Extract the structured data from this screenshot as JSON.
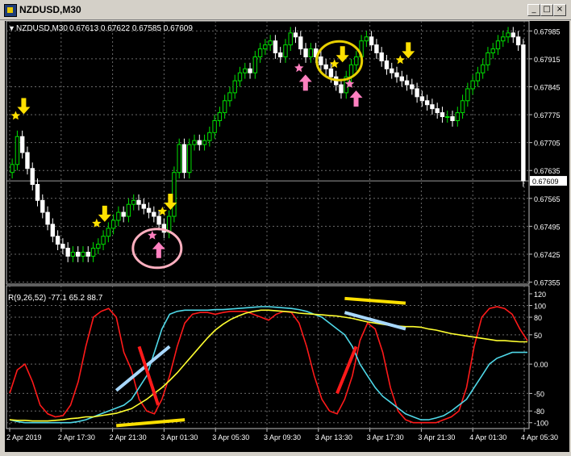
{
  "window": {
    "title": "NZDUSD,M30",
    "minimize_glyph": "_",
    "maximize_glyph": "□",
    "close_glyph": "×"
  },
  "colors": {
    "background": "#000000",
    "grid": "#6a6a6a",
    "bull_candle": "#00e000",
    "bear_candle": "#ffffff",
    "sell_arrow": "#ffe000",
    "buy_arrow": "#ff80c0",
    "rsi_fast": "#ff1a1a",
    "rsi_mid": "#4fd8e8",
    "rsi_slow": "#ffff30",
    "annotation_blue": "#a8d8ff",
    "annotation_red": "#ff1a1a",
    "annotation_yellow": "#ffe000",
    "circle_yellow": "#e8d000",
    "circle_pink": "#ffb0c0"
  },
  "main_chart": {
    "symbol_label": "NZDUSD,M30",
    "ohlc_label": "0.67613 0.67622 0.67585 0.67609",
    "current_price_label": "0.67609",
    "price_labels": [
      "0.67985",
      "0.67915",
      "0.67845",
      "0.67775",
      "0.67705",
      "0.67635",
      "0.67565",
      "0.67495",
      "0.67425",
      "0.67355"
    ]
  },
  "indicator": {
    "label": "R(9,26,52) -77.1 65.2 88.7",
    "level_labels": [
      "120",
      "100",
      "80",
      "50",
      "0.00",
      "-50",
      "-80",
      "-100"
    ]
  },
  "time_labels": [
    "2 Apr 2019",
    "2 Apr 17:30",
    "2 Apr 21:30",
    "3 Apr 01:30",
    "3 Apr 05:30",
    "3 Apr 09:30",
    "3 Apr 13:30",
    "3 Apr 17:30",
    "3 Apr 21:30",
    "4 Apr 01:30",
    "4 Apr 05:30"
  ],
  "icons": {
    "sell_signal": "yellow-down-arrow-icon",
    "buy_signal": "pink-up-arrow-icon",
    "sell_star": "yellow-star-icon",
    "buy_star": "pink-star-icon"
  },
  "chart_data": [
    {
      "type": "candlestick",
      "title": "NZDUSD,M30",
      "ylim": [
        0.6735,
        0.6801
      ],
      "grid": true,
      "y_ticks": [
        0.67985,
        0.67915,
        0.67845,
        0.67775,
        0.67705,
        0.67635,
        0.67565,
        0.67495,
        0.67425,
        0.67355
      ],
      "current_price": 0.67609,
      "series": [
        {
          "name": "close",
          "values": [
            0.6765,
            0.6772,
            0.6768,
            0.6764,
            0.676,
            0.6756,
            0.6753,
            0.675,
            0.6747,
            0.6745,
            0.6744,
            0.6742,
            0.6743,
            0.6742,
            0.6743,
            0.6742,
            0.6744,
            0.6745,
            0.6747,
            0.6749,
            0.6751,
            0.6753,
            0.6752,
            0.6755,
            0.6756,
            0.6755,
            0.6754,
            0.6753,
            0.6752,
            0.675,
            0.6748,
            0.6752,
            0.6763,
            0.677,
            0.6763,
            0.677,
            0.6771,
            0.677,
            0.6771,
            0.6773,
            0.6776,
            0.6778,
            0.6781,
            0.6783,
            0.6786,
            0.6788,
            0.6789,
            0.6788,
            0.6792,
            0.6794,
            0.6795,
            0.6796,
            0.6793,
            0.6792,
            0.6795,
            0.6798,
            0.6797,
            0.6794,
            0.6792,
            0.6794,
            0.6792,
            0.679,
            0.6789,
            0.6787,
            0.6785,
            0.6783,
            0.6787,
            0.679,
            0.6792,
            0.6796,
            0.6797,
            0.6795,
            0.6793,
            0.6791,
            0.6789,
            0.6788,
            0.6787,
            0.6786,
            0.6785,
            0.6784,
            0.6782,
            0.6781,
            0.678,
            0.6779,
            0.6778,
            0.6777,
            0.6777,
            0.6776,
            0.6778,
            0.6781,
            0.6784,
            0.6786,
            0.6788,
            0.679,
            0.6793,
            0.6794,
            0.6796,
            0.6797,
            0.6798,
            0.6797,
            0.6795,
            0.67609
          ]
        }
      ],
      "signals": [
        {
          "kind": "sell",
          "index": 1
        },
        {
          "kind": "sell",
          "index": 17
        },
        {
          "kind": "buy",
          "index": 28
        },
        {
          "kind": "sell",
          "index": 30
        },
        {
          "kind": "buy",
          "index": 57
        },
        {
          "kind": "sell",
          "index": 64
        },
        {
          "kind": "buy",
          "index": 67
        },
        {
          "kind": "sell",
          "index": 77
        }
      ]
    },
    {
      "type": "line",
      "title": "R(9,26,52)",
      "ylim": [
        -110,
        120
      ],
      "y_ticks": [
        120,
        100,
        80,
        50,
        0,
        -50,
        -80,
        -100
      ],
      "series": [
        {
          "name": "R9",
          "values": [
            -50,
            -10,
            0,
            -30,
            -70,
            -85,
            -90,
            -88,
            -70,
            -30,
            30,
            80,
            90,
            95,
            80,
            20,
            -10,
            -60,
            -80,
            -85,
            -60,
            -20,
            30,
            70,
            85,
            88,
            88,
            85,
            88,
            90,
            90,
            90,
            85,
            80,
            75,
            85,
            90,
            88,
            70,
            30,
            -20,
            -60,
            -80,
            -85,
            -60,
            -20,
            40,
            70,
            60,
            20,
            -40,
            -80,
            -95,
            -100,
            -100,
            -100,
            -100,
            -95,
            -90,
            -80,
            -40,
            30,
            80,
            95,
            98,
            95,
            85,
            60,
            40
          ]
        },
        {
          "name": "R26",
          "values": [
            -95,
            -98,
            -100,
            -100,
            -100,
            -100,
            -100,
            -100,
            -100,
            -98,
            -95,
            -90,
            -85,
            -80,
            -75,
            -70,
            -60,
            -40,
            -20,
            20,
            60,
            85,
            90,
            92,
            92,
            92,
            92,
            93,
            93,
            94,
            95,
            96,
            97,
            98,
            98,
            97,
            96,
            95,
            93,
            90,
            85,
            80,
            70,
            60,
            50,
            30,
            0,
            -20,
            -40,
            -55,
            -65,
            -75,
            -85,
            -90,
            -95,
            -95,
            -92,
            -88,
            -80,
            -70,
            -60,
            -40,
            -20,
            0,
            10,
            15,
            20,
            20,
            20
          ]
        },
        {
          "name": "R52",
          "values": [
            -95,
            -96,
            -96,
            -97,
            -97,
            -97,
            -96,
            -95,
            -93,
            -92,
            -90,
            -90,
            -88,
            -86,
            -84,
            -80,
            -76,
            -68,
            -60,
            -50,
            -40,
            -28,
            -15,
            0,
            15,
            30,
            45,
            58,
            68,
            76,
            82,
            87,
            90,
            92,
            92,
            91,
            90,
            89,
            87,
            86,
            85,
            84,
            83,
            82,
            80,
            78,
            75,
            72,
            70,
            68,
            66,
            65,
            64,
            64,
            63,
            60,
            58,
            55,
            52,
            50,
            48,
            46,
            44,
            42,
            40,
            40,
            39,
            38,
            38
          ]
        }
      ],
      "current_values": {
        "R9": -77.1,
        "R26": 65.2,
        "R52": 88.7
      }
    }
  ]
}
